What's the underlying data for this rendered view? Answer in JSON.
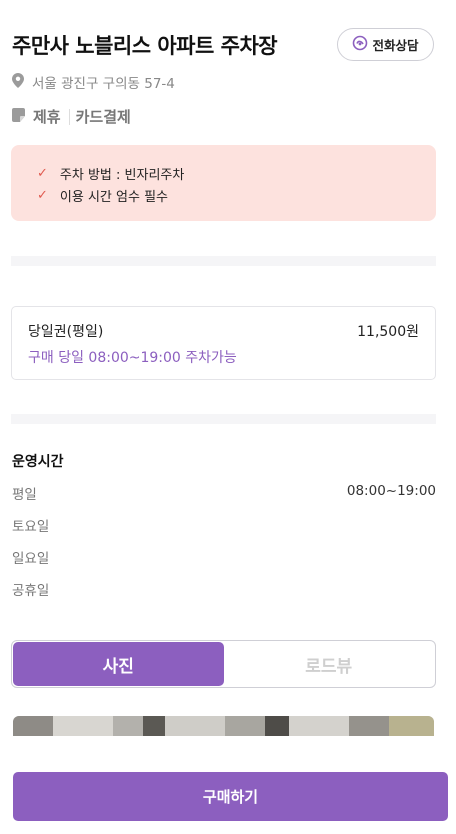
{
  "header": {
    "title": "주만사 노블리스 아파트 주차장",
    "call_button_label": "전화상담",
    "address": "서울 광진구 구의동 57-4",
    "tags": [
      "제휴",
      "카드결제"
    ]
  },
  "notice": {
    "items": [
      "주차 방법 : 빈자리주차",
      "이용 시간 엄수 필수"
    ]
  },
  "ticket": {
    "name": "당일권(평일)",
    "price": "11,500원",
    "description": "구매 당일 08:00~19:00 주차가능"
  },
  "hours": {
    "title": "운영시간",
    "rows": [
      {
        "day": "평일",
        "time": "08:00~19:00"
      },
      {
        "day": "토요일",
        "time": ""
      },
      {
        "day": "일요일",
        "time": ""
      },
      {
        "day": "공휴일",
        "time": ""
      }
    ]
  },
  "view_toggle": {
    "options": [
      "사진",
      "로드뷰"
    ],
    "selected": "사진"
  },
  "purchase": {
    "button_label": "구매하기"
  },
  "colors": {
    "accent": "#8c5fbf",
    "notice_bg": "#fde2de",
    "check": "#e05a4f"
  }
}
